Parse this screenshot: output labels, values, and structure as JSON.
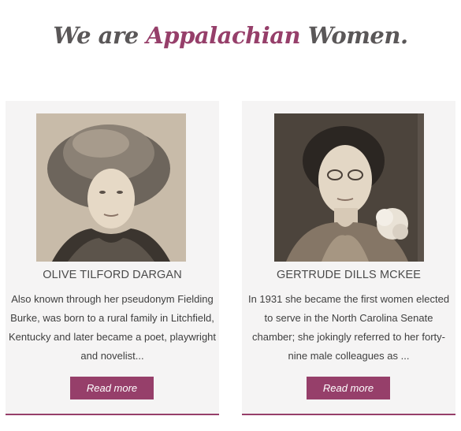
{
  "header": {
    "prefix": "We are",
    "accent": "Appalachian",
    "suffix": "Women."
  },
  "colors": {
    "accent": "#963f6a",
    "heading": "#5a5758",
    "card_bg": "#f5f4f4"
  },
  "cards": [
    {
      "name": "OLIVE TILFORD DARGAN",
      "bio": "Also known through her pseudonym Fielding Burke, was born to a rural family in Litchfield, Kentucky and later became a poet, playwright and novelist...",
      "button": "Read more"
    },
    {
      "name": "GERTRUDE DILLS MCKEE",
      "bio": "In 1931 she became the first women elected to serve in the North Carolina Senate chamber; she jokingly referred to her forty-nine male colleagues as ...",
      "button": "Read more"
    }
  ]
}
